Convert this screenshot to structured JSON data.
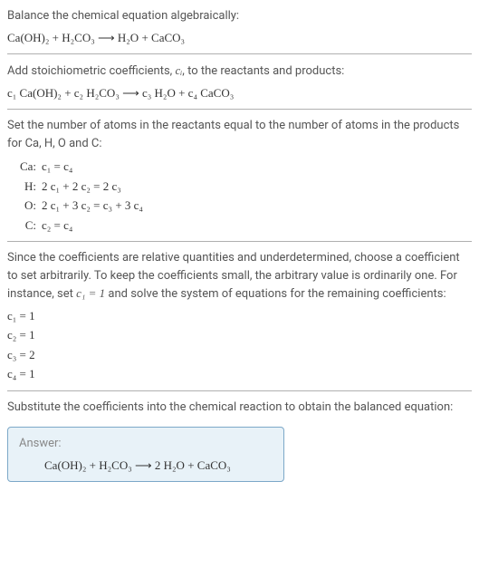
{
  "intro": {
    "line1": "Balance the chemical equation algebraically:",
    "eq": "Ca(OH)₂ + H₂CO₃ ⟶ H₂O + CaCO₃"
  },
  "stoich": {
    "line1_part1": "Add stoichiometric coefficients, ",
    "line1_var": "cᵢ",
    "line1_part2": ", to the reactants and products:",
    "eq": "c₁ Ca(OH)₂ + c₂ H₂CO₃ ⟶ c₃ H₂O + c₄ CaCO₃"
  },
  "atoms": {
    "line1": "Set the number of atoms in the reactants equal to the number of atoms in the products for Ca, H, O and C:",
    "rows": [
      {
        "el": "Ca:",
        "eq": "c₁ = c₄"
      },
      {
        "el": "H:",
        "eq": "2 c₁ + 2 c₂ = 2 c₃"
      },
      {
        "el": "O:",
        "eq": "2 c₁ + 3 c₂ = c₃ + 3 c₄"
      },
      {
        "el": "C:",
        "eq": "c₂ = c₄"
      }
    ]
  },
  "choose": {
    "text_part1": "Since the coefficients are relative quantities and underdetermined, choose a coefficient to set arbitrarily. To keep the coefficients small, the arbitrary value is ordinarily one. For instance, set ",
    "text_var": "c₁ = 1",
    "text_part2": " and solve the system of equations for the remaining coefficients:",
    "coeffs": [
      "c₁ = 1",
      "c₂ = 1",
      "c₃ = 2",
      "c₄ = 1"
    ]
  },
  "substitute": {
    "text": "Substitute the coefficients into the chemical reaction to obtain the balanced equation:"
  },
  "answer": {
    "label": "Answer:",
    "eq": "Ca(OH)₂ + H₂CO₃ ⟶ 2 H₂O + CaCO₃"
  }
}
